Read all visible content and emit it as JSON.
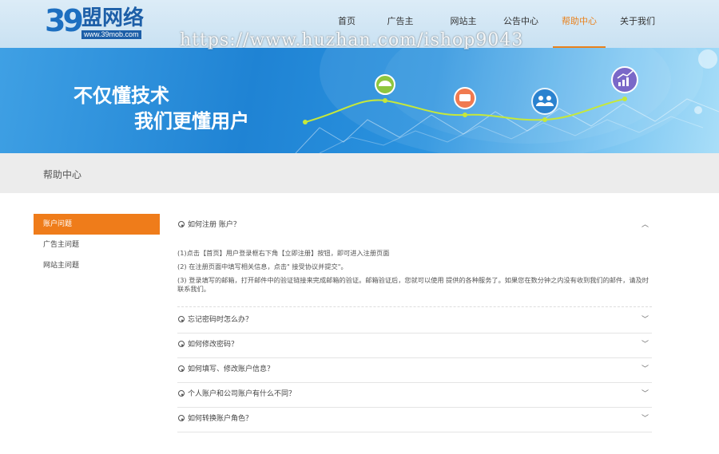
{
  "header": {
    "logo_number": "39",
    "logo_text": "盟网络",
    "logo_url": "www.39mob.com",
    "nav": [
      "首页",
      "广告主",
      "网站主",
      "公告中心",
      "帮助中心",
      "关于我们"
    ],
    "active_nav": "帮助中心",
    "accent_color": "#e9811c"
  },
  "watermark": "https://www.huzhan.com/ishop9043",
  "banner": {
    "slogan_line1": "不仅懂技术",
    "slogan_line2": "我们更懂用户"
  },
  "page_title": "帮助中心",
  "sidebar": {
    "items": [
      "账户问题",
      "广告主问题",
      "网站主问题"
    ],
    "active": "账户问题"
  },
  "faq": {
    "open_question": "如何注册 账户？",
    "open_answer": [
      "(1)点击【首页】用户登录框右下角【立即注册】按钮，即可进入注册页面",
      "(2) 在注册页面中填写相关信息，点击\" 接受协议并提交\"。",
      "(3) 登录填写的邮箱，打开邮件中的验证链接来完成邮箱的验证。邮箱验证后，您就可以使用 提供的各种服务了。如果您在数分钟之内没有收到我们的邮件，请及时联系我们。"
    ],
    "questions": [
      "忘记密码时怎么办？",
      "如何修改密码？",
      "如何填写、修改账户信息？",
      "个人账户和公司账户有什么不同？",
      "如何转换账户角色？"
    ]
  }
}
